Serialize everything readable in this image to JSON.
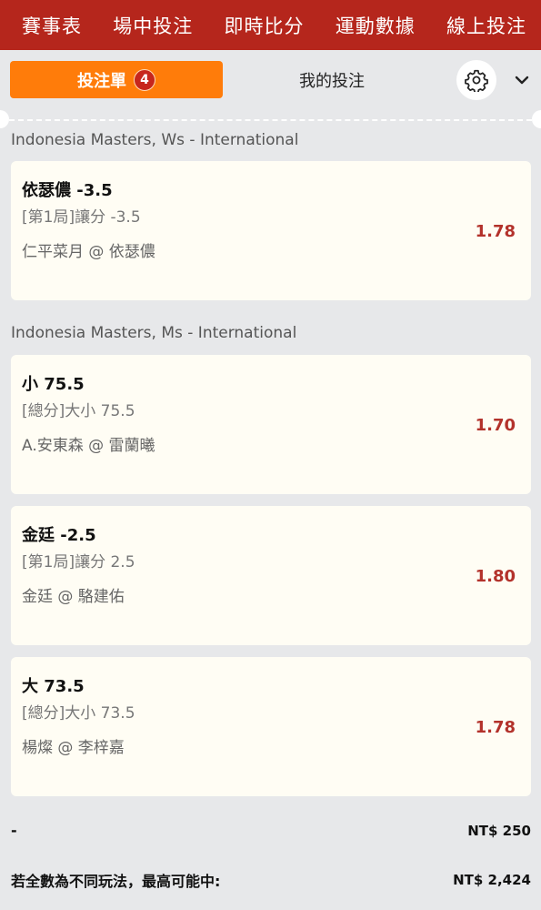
{
  "nav": {
    "items": [
      "賽事表",
      "場中投注",
      "即時比分",
      "運動數據",
      "線上投注"
    ]
  },
  "tabs": {
    "betslip_label": "投注單",
    "betslip_count": "4",
    "mybets_label": "我的投注"
  },
  "icons": {
    "settings": "gear-icon",
    "collapse": "chevron-down-icon"
  },
  "colors": {
    "nav_bg": "#b5261c",
    "active_tab": "#ff7c0a",
    "odds": "#b3322b"
  },
  "groups": [
    {
      "league": "Indonesia Masters, Ws - International",
      "bets": [
        {
          "selection": "依瑟儂 -3.5",
          "market": "[第1局]讓分 -3.5",
          "event": "仁平菜月 @ 依瑟儂",
          "odds": "1.78"
        }
      ]
    },
    {
      "league": "Indonesia Masters, Ms - International",
      "bets": [
        {
          "selection": "小 75.5",
          "market": "[總分]大小 75.5",
          "event": "A.安東森 @ 雷蘭曦",
          "odds": "1.70"
        },
        {
          "selection": "金廷 -2.5",
          "market": "[第1局]讓分 2.5",
          "event": "金廷 @ 駱建佑",
          "odds": "1.80"
        },
        {
          "selection": "大 73.5",
          "market": "[總分]大小 73.5",
          "event": "楊燦 @ 李梓嘉",
          "odds": "1.78"
        }
      ]
    }
  ],
  "summary": {
    "stake_label": "-",
    "stake_value": "NT$ 250",
    "max_win_label": "若全數為不同玩法，最高可能中:",
    "max_win_value": "NT$ 2,424"
  }
}
